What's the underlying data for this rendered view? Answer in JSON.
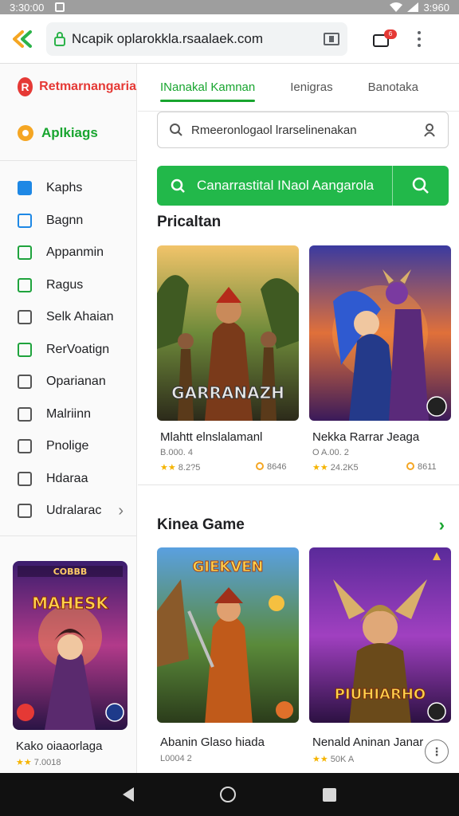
{
  "status_bar": {
    "time": "3:30:00",
    "battery": "3:960"
  },
  "browser": {
    "url": "Ncapik oplarokkla.rsaalaek.com",
    "tabs_badge": "6"
  },
  "sidebar": {
    "brand": "Retmarnangaria",
    "apps_label": "Aplkiags",
    "items": [
      {
        "label": "Kaphs",
        "icon": "grid-icon",
        "color": "#1e88e5"
      },
      {
        "label": "Bagnn",
        "icon": "camera-icon",
        "color": "#1e88e5"
      },
      {
        "label": "Appanmin",
        "icon": "link-icon",
        "color": "#1fa33d"
      },
      {
        "label": "Ragus",
        "icon": "card-icon",
        "color": "#1fa33d"
      },
      {
        "label": "Selk Ahaian",
        "icon": "check-icon",
        "color": "#555555"
      },
      {
        "label": "RerVoatign",
        "icon": "checkbox-icon",
        "color": "#1fa33d"
      },
      {
        "label": "Oparianan",
        "icon": "checkbox-icon",
        "color": "#555555"
      },
      {
        "label": "Malriinn",
        "icon": "bag-icon",
        "color": "#555555"
      },
      {
        "label": "Pnolige",
        "icon": "briefcase-icon",
        "color": "#555555"
      },
      {
        "label": "Hdaraa",
        "icon": "square-icon",
        "color": "#555555"
      },
      {
        "label": "Udralarac",
        "icon": "toggle-icon",
        "color": "#555555"
      }
    ],
    "card": {
      "title": "Kako oiaaorlaga",
      "rating_stars": "★★",
      "rating": "7.0018",
      "banner_top": "COBBB",
      "banner_text": "MAHESK"
    }
  },
  "main": {
    "tabs": [
      {
        "label": "INanakal Kamnan",
        "active": true
      },
      {
        "label": "Ienigras",
        "active": false
      },
      {
        "label": "Banotaka",
        "active": false
      }
    ],
    "search_text": "Rmeeronlogaol lrarselinenakan",
    "promo_text": "Canarrastital INaol Aangarola",
    "section1": {
      "title": "Pricaltan",
      "games": [
        {
          "title": "Mlahtt elnslalamanl",
          "sub": "B.000. 4",
          "stars": "★★",
          "rating": "8.2?5",
          "count": "8646",
          "art_text": "GARRANAZH"
        },
        {
          "title": "Nekka Rarrar Jeaga",
          "sub": "O A.00. 2",
          "stars": "★★",
          "rating": "24.2K5",
          "count": "8611",
          "art_text": ""
        }
      ]
    },
    "section2": {
      "title": "Kinea Game",
      "games": [
        {
          "title": "Abanin Glaso hiada",
          "sub": "L0004 2",
          "stars": "",
          "rating": "",
          "count": "",
          "art_text": "GIEKVEN"
        },
        {
          "title": "Nenald Aninan Janar",
          "sub": "50K A",
          "stars": "★★",
          "rating": "",
          "count": "",
          "art_text": "PIUHIARHO"
        }
      ]
    }
  }
}
